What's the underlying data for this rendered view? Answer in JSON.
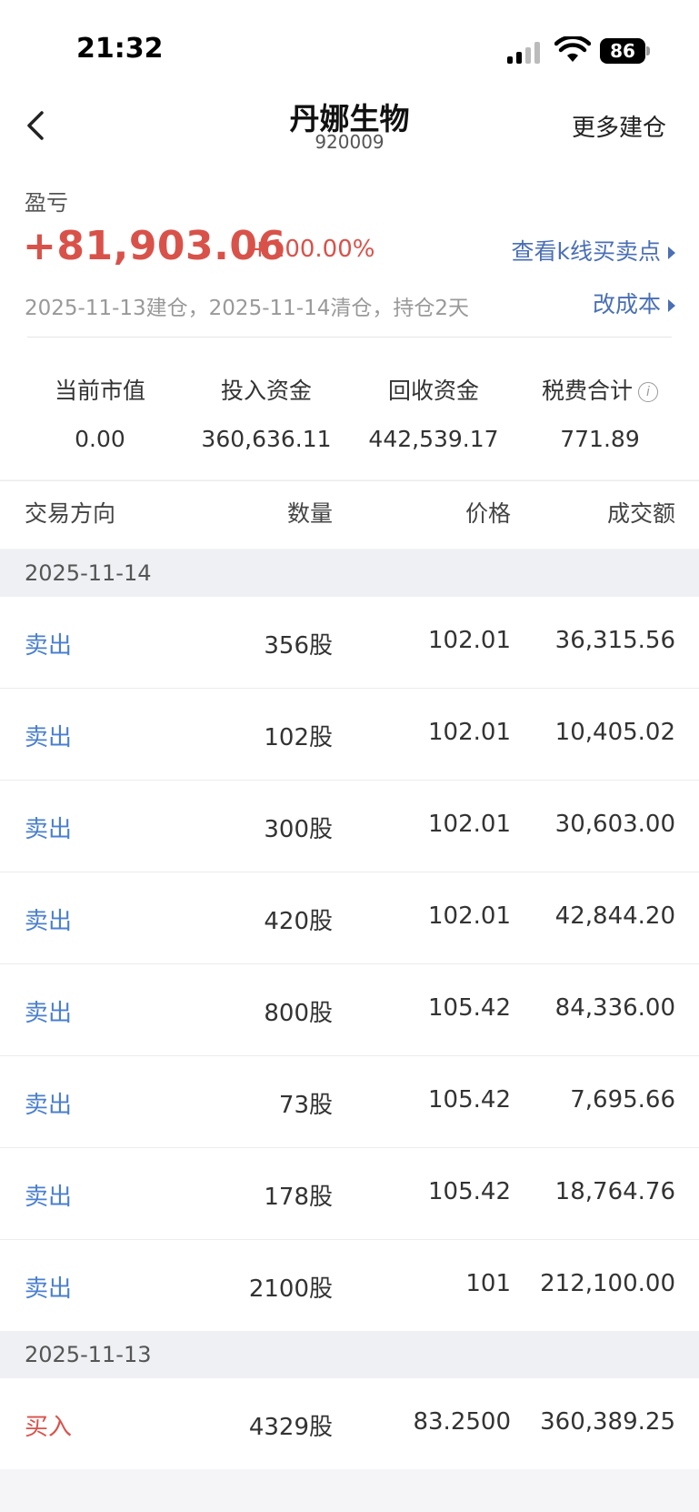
{
  "status_bar": {
    "time": "21:32",
    "battery": "86"
  },
  "nav": {
    "title": "丹娜生物",
    "code": "920009",
    "more_label": "更多建仓"
  },
  "summary": {
    "pl_label": "盈亏",
    "pl_value": "+81,903.06",
    "pl_pct": "+100.00%",
    "kline_link": "查看k线买卖点",
    "dates": "2025-11-13建仓，2025-11-14清仓，持仓2天",
    "cost_link": "改成本",
    "stats": [
      {
        "label": "当前市值",
        "value": "0.00"
      },
      {
        "label": "投入资金",
        "value": "360,636.11"
      },
      {
        "label": "回收资金",
        "value": "442,539.17"
      },
      {
        "label": "税费合计",
        "value": "771.89"
      }
    ]
  },
  "table": {
    "headers": {
      "direction": "交易方向",
      "quantity": "数量",
      "price": "价格",
      "amount": "成交额"
    },
    "groups": [
      {
        "date": "2025-11-14",
        "rows": [
          {
            "direction": "卖出",
            "quantity": "356股",
            "price": "102.01",
            "amount": "36,315.56"
          },
          {
            "direction": "卖出",
            "quantity": "102股",
            "price": "102.01",
            "amount": "10,405.02"
          },
          {
            "direction": "卖出",
            "quantity": "300股",
            "price": "102.01",
            "amount": "30,603.00"
          },
          {
            "direction": "卖出",
            "quantity": "420股",
            "price": "102.01",
            "amount": "42,844.20"
          },
          {
            "direction": "卖出",
            "quantity": "800股",
            "price": "105.42",
            "amount": "84,336.00"
          },
          {
            "direction": "卖出",
            "quantity": "73股",
            "price": "105.42",
            "amount": "7,695.66"
          },
          {
            "direction": "卖出",
            "quantity": "178股",
            "price": "105.42",
            "amount": "18,764.76"
          },
          {
            "direction": "卖出",
            "quantity": "2100股",
            "price": "101",
            "amount": "212,100.00"
          }
        ]
      },
      {
        "date": "2025-11-13",
        "rows": [
          {
            "direction": "买入",
            "quantity": "4329股",
            "price": "83.2500",
            "amount": "360,389.25"
          }
        ]
      }
    ]
  },
  "colors": {
    "profit": "#d9524a",
    "link": "#4a6fb5",
    "sell": "#4a7fd0",
    "buy": "#d9524a"
  }
}
